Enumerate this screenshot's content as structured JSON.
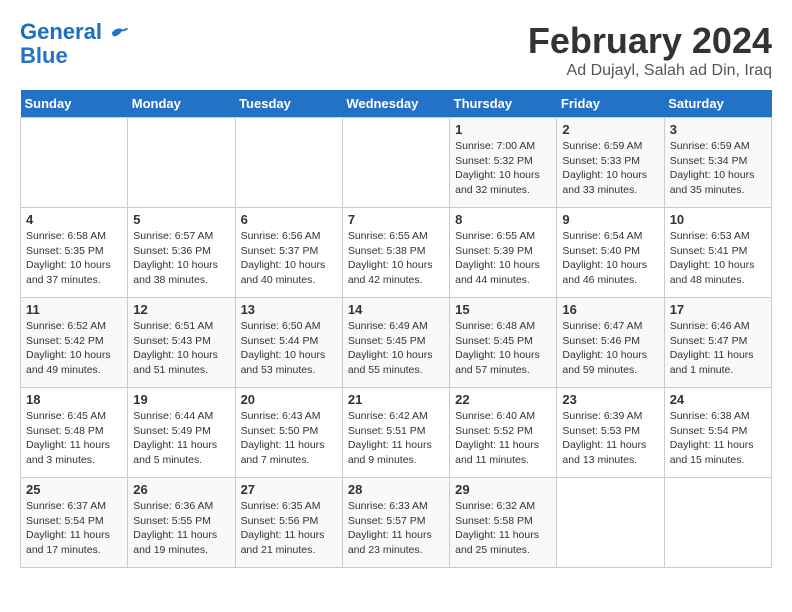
{
  "logo": {
    "line1": "General",
    "line2": "Blue"
  },
  "title": "February 2024",
  "subtitle": "Ad Dujayl, Salah ad Din, Iraq",
  "weekdays": [
    "Sunday",
    "Monday",
    "Tuesday",
    "Wednesday",
    "Thursday",
    "Friday",
    "Saturday"
  ],
  "weeks": [
    [
      {
        "day": "",
        "info": ""
      },
      {
        "day": "",
        "info": ""
      },
      {
        "day": "",
        "info": ""
      },
      {
        "day": "",
        "info": ""
      },
      {
        "day": "1",
        "info": "Sunrise: 7:00 AM\nSunset: 5:32 PM\nDaylight: 10 hours\nand 32 minutes."
      },
      {
        "day": "2",
        "info": "Sunrise: 6:59 AM\nSunset: 5:33 PM\nDaylight: 10 hours\nand 33 minutes."
      },
      {
        "day": "3",
        "info": "Sunrise: 6:59 AM\nSunset: 5:34 PM\nDaylight: 10 hours\nand 35 minutes."
      }
    ],
    [
      {
        "day": "4",
        "info": "Sunrise: 6:58 AM\nSunset: 5:35 PM\nDaylight: 10 hours\nand 37 minutes."
      },
      {
        "day": "5",
        "info": "Sunrise: 6:57 AM\nSunset: 5:36 PM\nDaylight: 10 hours\nand 38 minutes."
      },
      {
        "day": "6",
        "info": "Sunrise: 6:56 AM\nSunset: 5:37 PM\nDaylight: 10 hours\nand 40 minutes."
      },
      {
        "day": "7",
        "info": "Sunrise: 6:55 AM\nSunset: 5:38 PM\nDaylight: 10 hours\nand 42 minutes."
      },
      {
        "day": "8",
        "info": "Sunrise: 6:55 AM\nSunset: 5:39 PM\nDaylight: 10 hours\nand 44 minutes."
      },
      {
        "day": "9",
        "info": "Sunrise: 6:54 AM\nSunset: 5:40 PM\nDaylight: 10 hours\nand 46 minutes."
      },
      {
        "day": "10",
        "info": "Sunrise: 6:53 AM\nSunset: 5:41 PM\nDaylight: 10 hours\nand 48 minutes."
      }
    ],
    [
      {
        "day": "11",
        "info": "Sunrise: 6:52 AM\nSunset: 5:42 PM\nDaylight: 10 hours\nand 49 minutes."
      },
      {
        "day": "12",
        "info": "Sunrise: 6:51 AM\nSunset: 5:43 PM\nDaylight: 10 hours\nand 51 minutes."
      },
      {
        "day": "13",
        "info": "Sunrise: 6:50 AM\nSunset: 5:44 PM\nDaylight: 10 hours\nand 53 minutes."
      },
      {
        "day": "14",
        "info": "Sunrise: 6:49 AM\nSunset: 5:45 PM\nDaylight: 10 hours\nand 55 minutes."
      },
      {
        "day": "15",
        "info": "Sunrise: 6:48 AM\nSunset: 5:45 PM\nDaylight: 10 hours\nand 57 minutes."
      },
      {
        "day": "16",
        "info": "Sunrise: 6:47 AM\nSunset: 5:46 PM\nDaylight: 10 hours\nand 59 minutes."
      },
      {
        "day": "17",
        "info": "Sunrise: 6:46 AM\nSunset: 5:47 PM\nDaylight: 11 hours\nand 1 minute."
      }
    ],
    [
      {
        "day": "18",
        "info": "Sunrise: 6:45 AM\nSunset: 5:48 PM\nDaylight: 11 hours\nand 3 minutes."
      },
      {
        "day": "19",
        "info": "Sunrise: 6:44 AM\nSunset: 5:49 PM\nDaylight: 11 hours\nand 5 minutes."
      },
      {
        "day": "20",
        "info": "Sunrise: 6:43 AM\nSunset: 5:50 PM\nDaylight: 11 hours\nand 7 minutes."
      },
      {
        "day": "21",
        "info": "Sunrise: 6:42 AM\nSunset: 5:51 PM\nDaylight: 11 hours\nand 9 minutes."
      },
      {
        "day": "22",
        "info": "Sunrise: 6:40 AM\nSunset: 5:52 PM\nDaylight: 11 hours\nand 11 minutes."
      },
      {
        "day": "23",
        "info": "Sunrise: 6:39 AM\nSunset: 5:53 PM\nDaylight: 11 hours\nand 13 minutes."
      },
      {
        "day": "24",
        "info": "Sunrise: 6:38 AM\nSunset: 5:54 PM\nDaylight: 11 hours\nand 15 minutes."
      }
    ],
    [
      {
        "day": "25",
        "info": "Sunrise: 6:37 AM\nSunset: 5:54 PM\nDaylight: 11 hours\nand 17 minutes."
      },
      {
        "day": "26",
        "info": "Sunrise: 6:36 AM\nSunset: 5:55 PM\nDaylight: 11 hours\nand 19 minutes."
      },
      {
        "day": "27",
        "info": "Sunrise: 6:35 AM\nSunset: 5:56 PM\nDaylight: 11 hours\nand 21 minutes."
      },
      {
        "day": "28",
        "info": "Sunrise: 6:33 AM\nSunset: 5:57 PM\nDaylight: 11 hours\nand 23 minutes."
      },
      {
        "day": "29",
        "info": "Sunrise: 6:32 AM\nSunset: 5:58 PM\nDaylight: 11 hours\nand 25 minutes."
      },
      {
        "day": "",
        "info": ""
      },
      {
        "day": "",
        "info": ""
      }
    ]
  ]
}
